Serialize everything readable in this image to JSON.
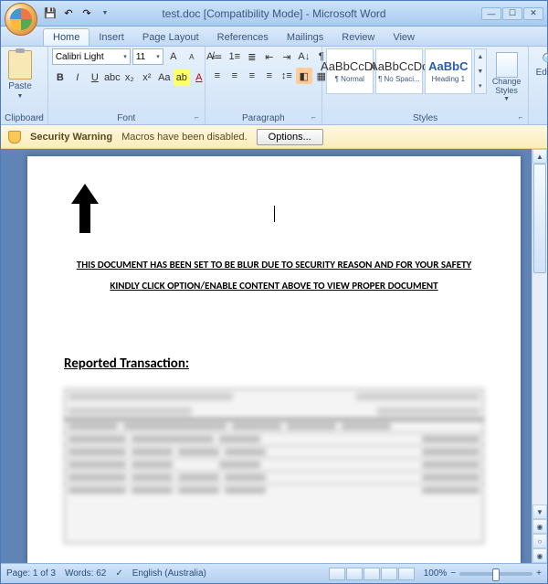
{
  "title": "test.doc [Compatibility Mode] - Microsoft Word",
  "tabs": [
    "Home",
    "Insert",
    "Page Layout",
    "References",
    "Mailings",
    "Review",
    "View"
  ],
  "active_tab": 0,
  "ribbon": {
    "clipboard": {
      "paste": "Paste",
      "group": "Clipboard"
    },
    "font": {
      "name": "Calibri Light",
      "size": "11",
      "group": "Font"
    },
    "paragraph": {
      "group": "Paragraph"
    },
    "styles": {
      "items": [
        {
          "sample": "AaBbCcDc",
          "name": "¶ Normal"
        },
        {
          "sample": "AaBbCcDc",
          "name": "¶ No Spaci..."
        },
        {
          "sample": "AaBbC",
          "name": "Heading 1"
        }
      ],
      "change": "Change Styles",
      "group": "Styles"
    },
    "editing": {
      "label": "Editing"
    }
  },
  "security": {
    "label": "Security Warning",
    "text": "Macros have been disabled.",
    "button": "Options..."
  },
  "document": {
    "message1": "THIS DOCUMENT HAS BEEN SET TO BE BLUR DUE TO SECURITY REASON AND FOR YOUR SAFETY",
    "message2": "KINDLY CLICK OPTION/ENABLE CONTENT ABOVE TO VIEW PROPER DOCUMENT",
    "heading": "Reported Transaction:"
  },
  "status": {
    "page": "Page: 1 of 3",
    "words": "Words: 62",
    "lang": "English (Australia)",
    "zoom": "100%"
  }
}
